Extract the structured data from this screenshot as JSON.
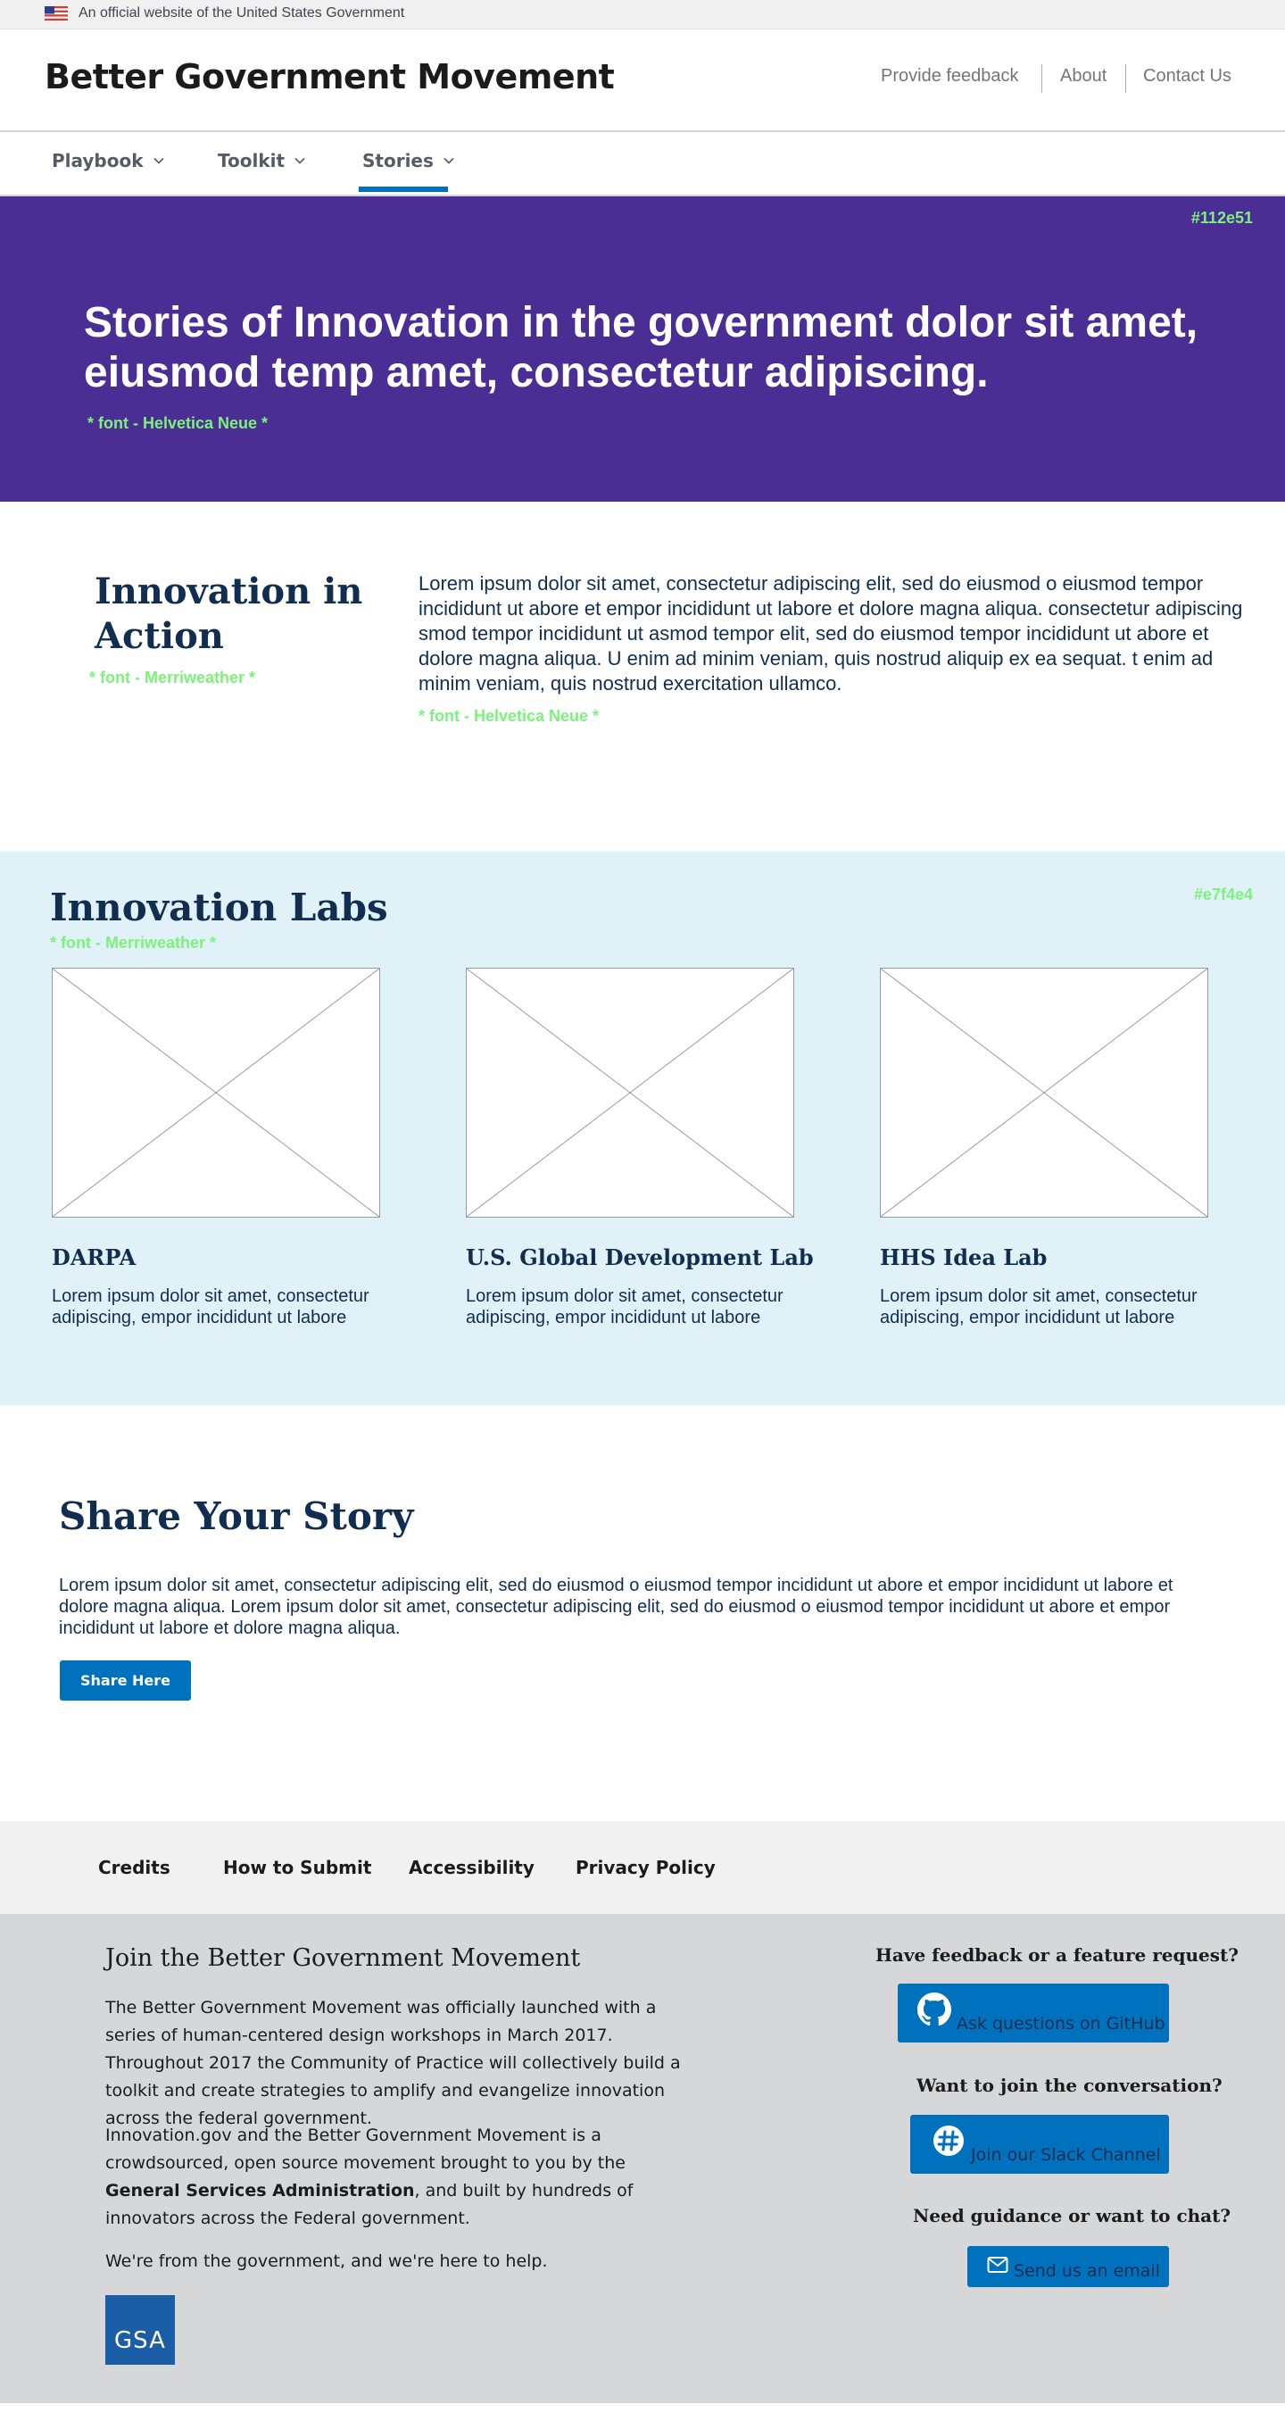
{
  "gov_banner": {
    "text": "An official website of the United States Government"
  },
  "header": {
    "site_title": "Better Government Movement",
    "links": [
      "Provide feedback",
      "About",
      "Contact Us"
    ]
  },
  "nav": {
    "items": [
      {
        "label": "Playbook",
        "active": false
      },
      {
        "label": "Toolkit",
        "active": false
      },
      {
        "label": "Stories",
        "active": true
      }
    ]
  },
  "hero": {
    "color_note": "#112e51",
    "title": "Stories of Innovation in the government dolor sit amet, eiusmod temp amet, consectetur adipiscing.",
    "font_note": "* font - Helvetica Neue *",
    "background": "#4a2e93"
  },
  "innovation_in_action": {
    "title": "Innovation in Action",
    "font_note": "* font - Merriweather *",
    "body": "Lorem ipsum dolor sit amet, consectetur adipiscing elit,  sed do eiusmod  o eiusmod tempor incididunt ut abore et  empor incididunt ut labore et dolore magna aliqua. consectetur adipiscing smod tempor incididunt ut asmod tempor elit,  sed do eiusmod tempor incididunt ut abore et dolore magna aliqua. U enim ad minim veniam, quis nostrud aliquip ex ea sequat. t enim ad minim veniam, quis nostrud  exercitation ullamco.",
    "body_font_note": "* font - Helvetica Neue *"
  },
  "labs": {
    "title": "Innovation Labs",
    "font_note": "* font - Merriweather *",
    "color_note": "#e7f4e4",
    "background": "#e0f1f7",
    "items": [
      {
        "name": "DARPA",
        "description": "Lorem ipsum dolor sit amet, consectetur adipiscing, empor incididunt ut labore"
      },
      {
        "name": "U.S. Global Development Lab",
        "description": "Lorem ipsum dolor sit amet, consectetur adipiscing, empor incididunt ut labore"
      },
      {
        "name": "HHS Idea Lab",
        "description": "Lorem ipsum dolor sit amet, consectetur adipiscing, empor incididunt ut labore"
      }
    ]
  },
  "share": {
    "title": "Share Your Story",
    "body": "Lorem ipsum dolor sit amet, consectetur adipiscing elit,  sed do eiusmod  o eiusmod tempor incididunt ut abore et  empor incididunt ut labore et dolore magna aliqua.  Lorem ipsum dolor sit amet, consectetur adipiscing elit,  sed do eiusmod  o eiusmod tempor incididunt ut abore et empor incididunt ut labore et dolore magna aliqua.",
    "button": "Share Here"
  },
  "footer_links": [
    "Credits",
    "How to Submit",
    "Accessibility",
    "Privacy Policy"
  ],
  "footer": {
    "join_title": "Join the Better Government Movement",
    "p1": "The Better Government Movement was officially launched with a series of human-centered design workshops in March 2017. Throughout 2017 the Community of Practice will collectively build a toolkit and create strategies to amplify and evangelize innovation across the federal government.",
    "p2_before": "Innovation.gov and the Better Government Movement is a crowdsourced, open source movement brought to you by the ",
    "p2_bold": "General Services Administration",
    "p2_after": ", and built by hundreds of innovators across the Federal government.",
    "p3": "We're from the government, and we're here to help.",
    "gsa_logo": "GSA",
    "ctas": [
      {
        "question": "Have feedback or a feature request?",
        "button": "Ask questions on GitHub",
        "icon": "github-icon"
      },
      {
        "question": "Want to join the conversation?",
        "button": "Join our Slack Channel",
        "icon": "slack-icon"
      },
      {
        "question": "Need guidance or want to chat?",
        "button": "Send us an email",
        "icon": "mail-icon"
      }
    ]
  }
}
